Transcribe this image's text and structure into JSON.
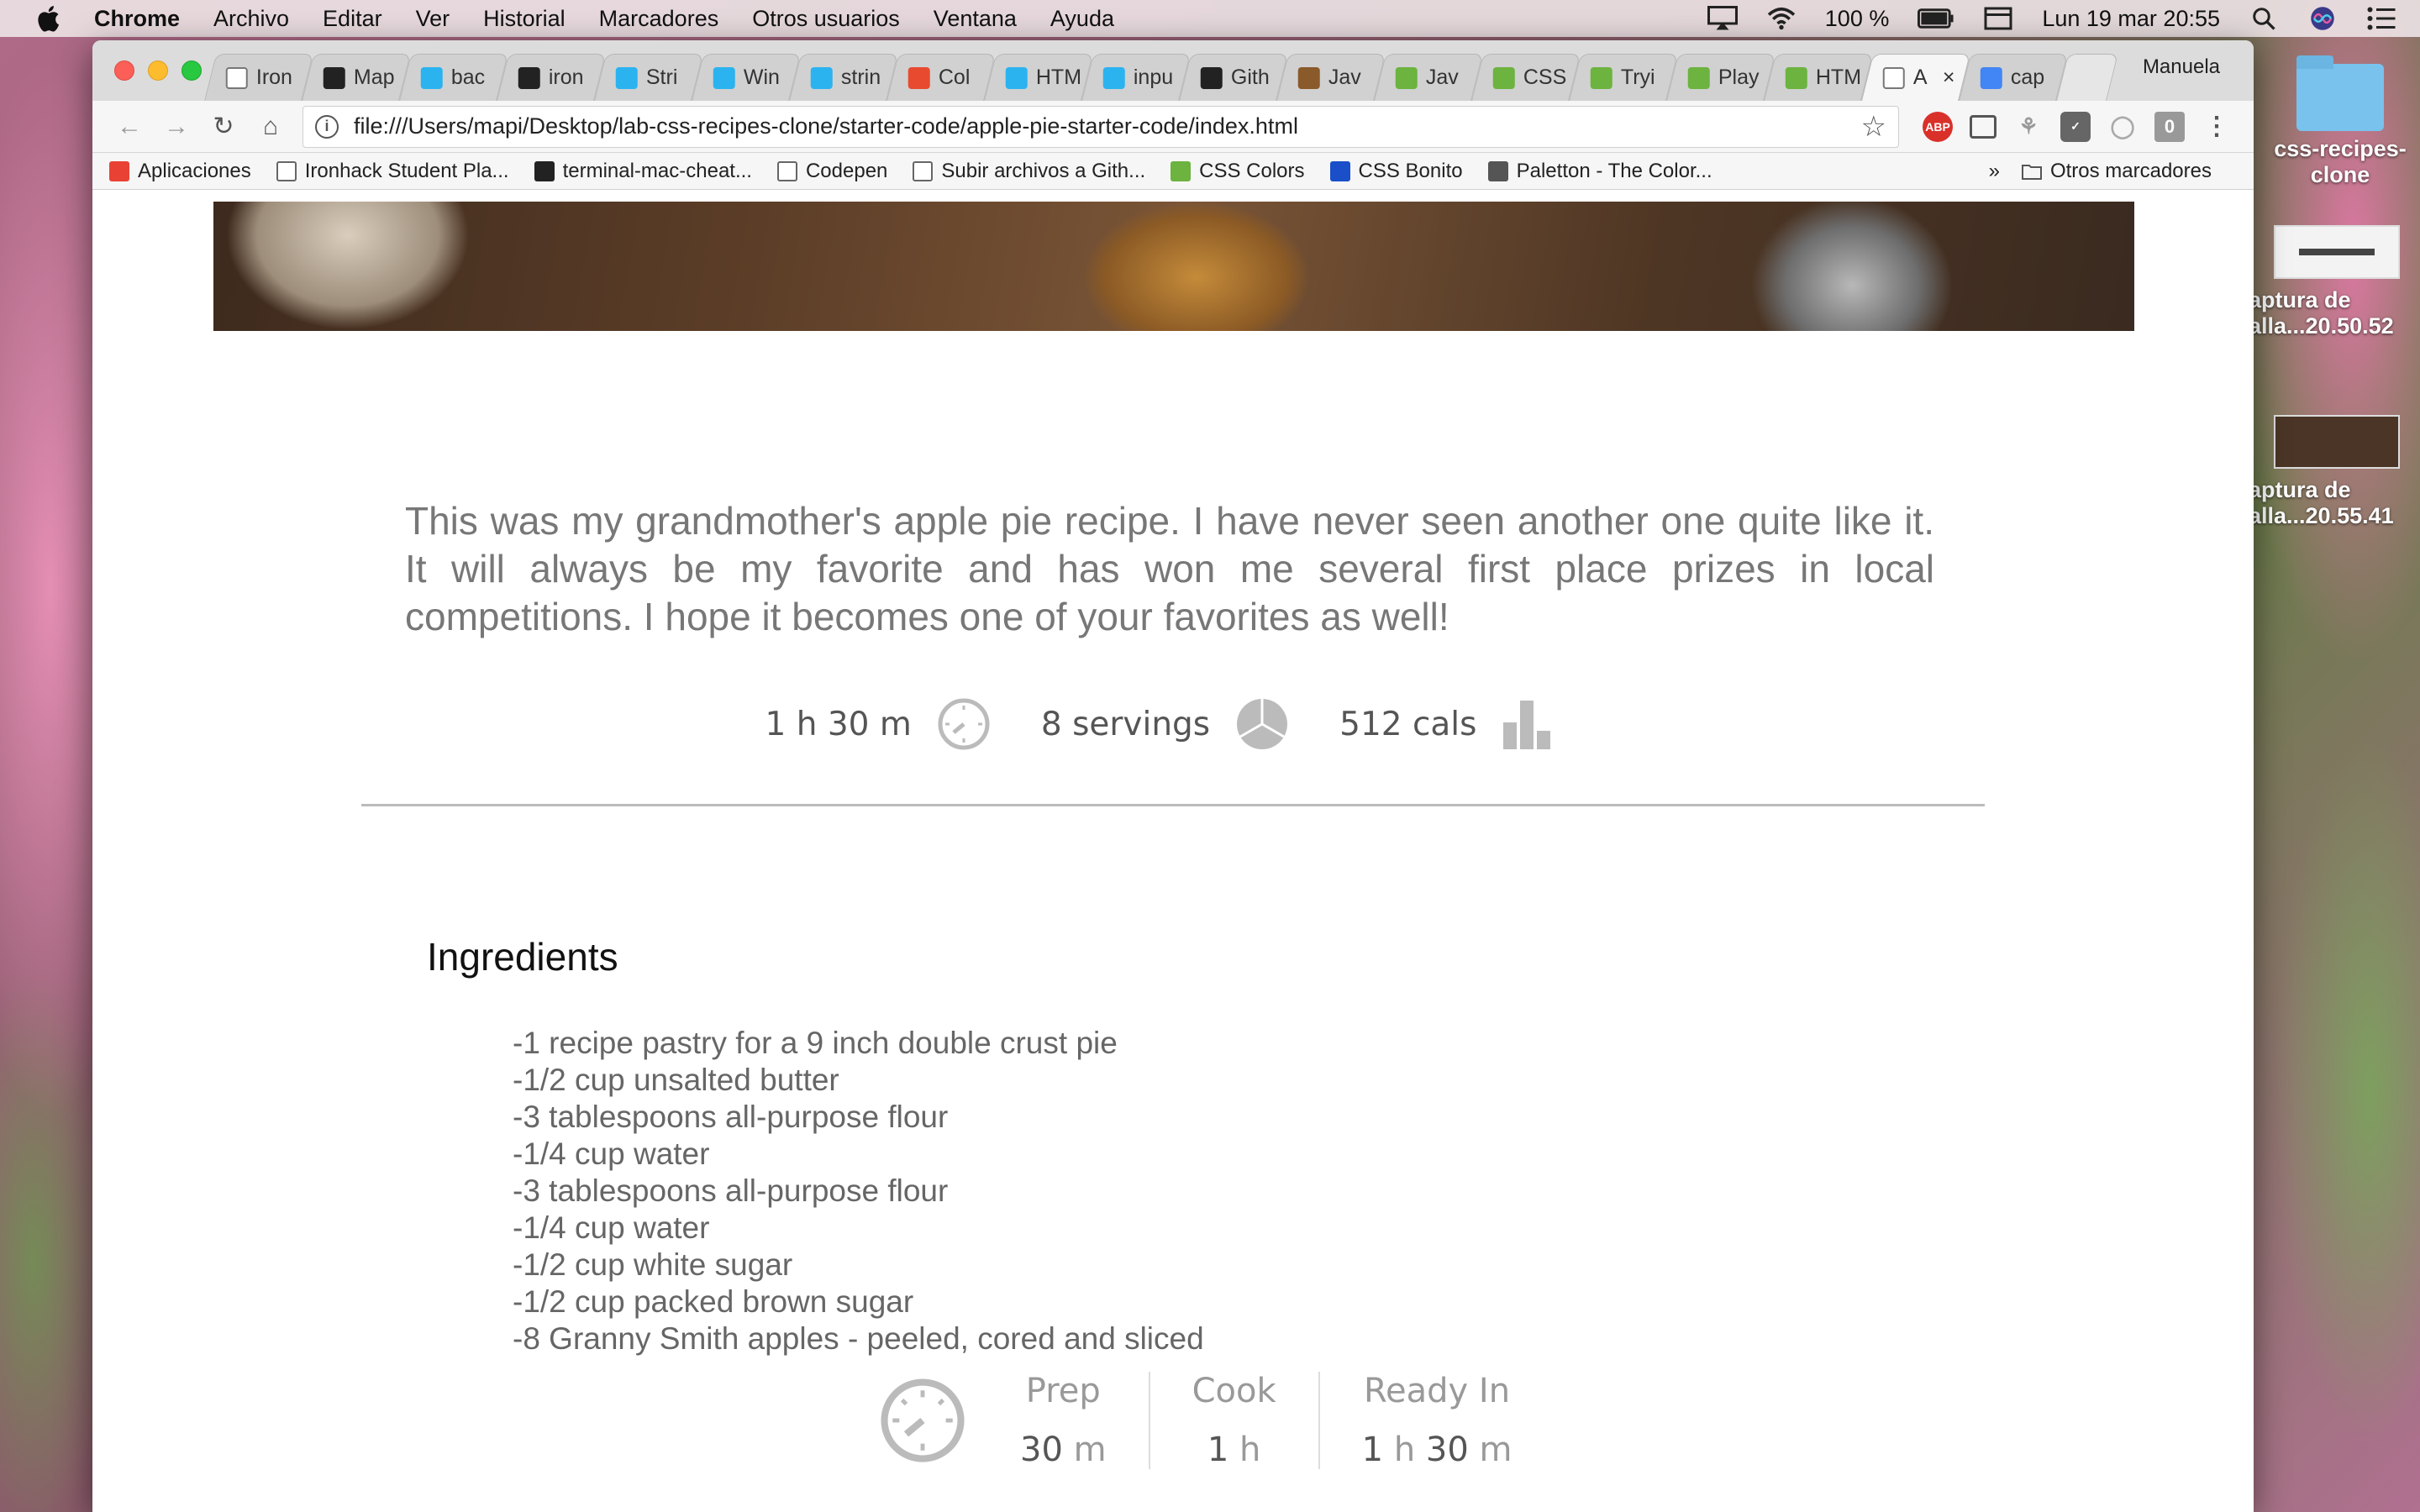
{
  "menubar": {
    "app": "Chrome",
    "items": [
      "Archivo",
      "Editar",
      "Ver",
      "Historial",
      "Marcadores",
      "Otros usuarios",
      "Ventana",
      "Ayuda"
    ],
    "battery": "100 %",
    "datetime": "Lun 19 mar  20:55"
  },
  "browser": {
    "profile": "Manuela",
    "tabs": [
      {
        "title": "Iron",
        "icon": "page-icon",
        "color": "#ffffff"
      },
      {
        "title": "Map",
        "icon": "github-icon",
        "color": "#222222"
      },
      {
        "title": "bac",
        "icon": "ironhack-icon",
        "color": "#2bb3f0"
      },
      {
        "title": "iron",
        "icon": "github-icon",
        "color": "#222222"
      },
      {
        "title": "Stri",
        "icon": "ironhack-icon",
        "color": "#2bb3f0"
      },
      {
        "title": "Win",
        "icon": "ironhack-icon",
        "color": "#2bb3f0"
      },
      {
        "title": "strin",
        "icon": "ironhack-icon",
        "color": "#2bb3f0"
      },
      {
        "title": "Col",
        "icon": "colorpicker-icon",
        "color": "#e84a2f"
      },
      {
        "title": "HTM",
        "icon": "ironhack-icon",
        "color": "#2bb3f0"
      },
      {
        "title": "inpu",
        "icon": "ironhack-icon",
        "color": "#2bb3f0"
      },
      {
        "title": "Gith",
        "icon": "github-icon",
        "color": "#222222"
      },
      {
        "title": "Jav",
        "icon": "books-icon",
        "color": "#8a5a2a"
      },
      {
        "title": "Jav",
        "icon": "w3schools-icon",
        "color": "#6cb33f"
      },
      {
        "title": "CSS",
        "icon": "w3schools-icon",
        "color": "#6cb33f"
      },
      {
        "title": "Tryi",
        "icon": "w3schools-icon",
        "color": "#6cb33f"
      },
      {
        "title": "Play",
        "icon": "w3schools-icon",
        "color": "#6cb33f"
      },
      {
        "title": "HTM",
        "icon": "w3schools-icon",
        "color": "#6cb33f"
      },
      {
        "title": "A",
        "icon": "page-icon",
        "color": "#ffffff"
      },
      {
        "title": "cap",
        "icon": "google-icon",
        "color": "#4285f4"
      }
    ],
    "url": "file:///Users/mapi/Desktop/lab-css-recipes-clone/starter-code/apple-pie-starter-code/index.html",
    "bookmarks": [
      {
        "label": "Aplicaciones",
        "icon": "apps-grid-icon",
        "color": "#e94235"
      },
      {
        "label": "Ironhack Student Pla...",
        "icon": "page-icon",
        "color": "#ffffff"
      },
      {
        "label": "terminal-mac-cheat...",
        "icon": "github-icon",
        "color": "#222222"
      },
      {
        "label": "Codepen",
        "icon": "codepen-icon",
        "color": "#ffffff"
      },
      {
        "label": "Subir archivos a Gith...",
        "icon": "page-icon",
        "color": "#ffffff"
      },
      {
        "label": "CSS Colors",
        "icon": "w3schools-icon",
        "color": "#6cb33f"
      },
      {
        "label": "CSS Bonito",
        "icon": "dans-tools-icon",
        "color": "#1a4fc9"
      },
      {
        "label": "Paletton - The Color...",
        "icon": "paletton-icon",
        "color": "#555555"
      }
    ],
    "bookmarks_more": "»",
    "other_bookmarks": "Otros marcadores"
  },
  "recipe": {
    "intro": "This was my grandmother's apple pie recipe. I have never seen another one quite like it. It will always be my favorite and has won me several first place prizes in local competitions. I hope it becomes one of your favorites as well!",
    "stats": {
      "time": "1 h 30 m",
      "servings": "8 servings",
      "calories": "512 cals"
    },
    "ingredients_title": "Ingredients",
    "ingredients": [
      "-1 recipe pastry for a 9 inch double crust pie",
      "-1/2 cup unsalted butter",
      "-3 tablespoons all-purpose flour",
      "-1/4 cup water",
      "-3 tablespoons all-purpose flour",
      "-1/4 cup water",
      "-1/2 cup white sugar",
      "-1/2 cup packed brown sugar",
      "-8 Granny Smith apples - peeled, cored and sliced"
    ],
    "times": {
      "prep": {
        "label": "Prep",
        "num": "30",
        "unit": "m"
      },
      "cook": {
        "label": "Cook",
        "num": "1",
        "unit": "h"
      },
      "ready": {
        "label": "Ready In",
        "num1": "1",
        "unit1": "h",
        "num2": "30",
        "unit2": "m"
      }
    }
  },
  "desktop": {
    "folder_label": "css-recipes-\nclone",
    "shot1_label": "aptura de\nalla...20.50.52",
    "shot2_label": "aptura de\nalla...20.55.41"
  }
}
